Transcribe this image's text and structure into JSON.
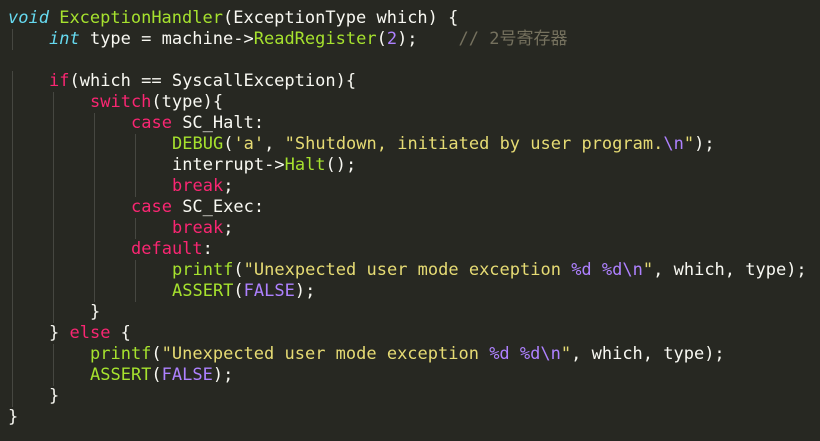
{
  "code": {
    "lines": [
      {
        "indent": 0,
        "tokens": [
          {
            "t": "void",
            "k": "type"
          },
          {
            "t": " ",
            "k": "plain"
          },
          {
            "t": "ExceptionHandler",
            "k": "fn"
          },
          {
            "t": "(ExceptionType which) {",
            "k": "plain"
          }
        ]
      },
      {
        "indent": 1,
        "tokens": [
          {
            "t": "int",
            "k": "type"
          },
          {
            "t": " type = machine",
            "k": "plain"
          },
          {
            "t": "->",
            "k": "plain"
          },
          {
            "t": "ReadRegister",
            "k": "fn"
          },
          {
            "t": "(",
            "k": "plain"
          },
          {
            "t": "2",
            "k": "num"
          },
          {
            "t": ");",
            "k": "plain"
          },
          {
            "t": "    ",
            "k": "plain"
          },
          {
            "t": "// 2号寄存器",
            "k": "cmt"
          }
        ]
      },
      {
        "indent": 0,
        "tokens": []
      },
      {
        "indent": 1,
        "tokens": [
          {
            "t": "if",
            "k": "kw"
          },
          {
            "t": "(which == SyscallException){",
            "k": "plain"
          }
        ]
      },
      {
        "indent": 2,
        "tokens": [
          {
            "t": "switch",
            "k": "kw"
          },
          {
            "t": "(type){",
            "k": "plain"
          }
        ]
      },
      {
        "indent": 3,
        "tokens": [
          {
            "t": "case",
            "k": "kw"
          },
          {
            "t": " SC_Halt:",
            "k": "plain"
          }
        ]
      },
      {
        "indent": 4,
        "tokens": [
          {
            "t": "DEBUG",
            "k": "fn"
          },
          {
            "t": "(",
            "k": "plain"
          },
          {
            "t": "'a'",
            "k": "str"
          },
          {
            "t": ", ",
            "k": "plain"
          },
          {
            "t": "\"Shutdown, initiated by user program.",
            "k": "str"
          },
          {
            "t": "\\n",
            "k": "esc"
          },
          {
            "t": "\"",
            "k": "str"
          },
          {
            "t": ");",
            "k": "plain"
          }
        ]
      },
      {
        "indent": 4,
        "tokens": [
          {
            "t": "interrupt->",
            "k": "plain"
          },
          {
            "t": "Halt",
            "k": "fn"
          },
          {
            "t": "();",
            "k": "plain"
          }
        ]
      },
      {
        "indent": 4,
        "tokens": [
          {
            "t": "break",
            "k": "kw"
          },
          {
            "t": ";",
            "k": "plain"
          }
        ]
      },
      {
        "indent": 3,
        "tokens": [
          {
            "t": "case",
            "k": "kw"
          },
          {
            "t": " SC_Exec:",
            "k": "plain"
          }
        ]
      },
      {
        "indent": 4,
        "tokens": [
          {
            "t": "break",
            "k": "kw"
          },
          {
            "t": ";",
            "k": "plain"
          }
        ]
      },
      {
        "indent": 3,
        "tokens": [
          {
            "t": "default",
            "k": "kw"
          },
          {
            "t": ":",
            "k": "plain"
          }
        ]
      },
      {
        "indent": 4,
        "tokens": [
          {
            "t": "printf",
            "k": "fn"
          },
          {
            "t": "(",
            "k": "plain"
          },
          {
            "t": "\"Unexpected user mode exception ",
            "k": "str"
          },
          {
            "t": "%d",
            "k": "esc"
          },
          {
            "t": " ",
            "k": "str"
          },
          {
            "t": "%d",
            "k": "esc"
          },
          {
            "t": "\\n",
            "k": "esc"
          },
          {
            "t": "\"",
            "k": "str"
          },
          {
            "t": ", which, type);",
            "k": "plain"
          }
        ]
      },
      {
        "indent": 4,
        "tokens": [
          {
            "t": "ASSERT",
            "k": "fn"
          },
          {
            "t": "(",
            "k": "plain"
          },
          {
            "t": "FALSE",
            "k": "const"
          },
          {
            "t": ");",
            "k": "plain"
          }
        ]
      },
      {
        "indent": 2,
        "tokens": [
          {
            "t": "}",
            "k": "plain"
          }
        ]
      },
      {
        "indent": 1,
        "tokens": [
          {
            "t": "} ",
            "k": "plain"
          },
          {
            "t": "else",
            "k": "kw"
          },
          {
            "t": " {",
            "k": "plain"
          }
        ]
      },
      {
        "indent": 2,
        "tokens": [
          {
            "t": "printf",
            "k": "fn"
          },
          {
            "t": "(",
            "k": "plain"
          },
          {
            "t": "\"Unexpected user mode exception ",
            "k": "str"
          },
          {
            "t": "%d",
            "k": "esc"
          },
          {
            "t": " ",
            "k": "str"
          },
          {
            "t": "%d",
            "k": "esc"
          },
          {
            "t": "\\n",
            "k": "esc"
          },
          {
            "t": "\"",
            "k": "str"
          },
          {
            "t": ", which, type);",
            "k": "plain"
          }
        ]
      },
      {
        "indent": 2,
        "tokens": [
          {
            "t": "ASSERT",
            "k": "fn"
          },
          {
            "t": "(",
            "k": "plain"
          },
          {
            "t": "FALSE",
            "k": "const"
          },
          {
            "t": ");",
            "k": "plain"
          }
        ]
      },
      {
        "indent": 1,
        "tokens": [
          {
            "t": "}",
            "k": "plain"
          }
        ]
      },
      {
        "indent": 0,
        "tokens": [
          {
            "t": "}",
            "k": "plain"
          }
        ]
      }
    ]
  },
  "theme": {
    "background": "#272822",
    "foreground": "#f8f8f2",
    "keyword": "#f92672",
    "type": "#66d9ef",
    "function": "#a6e22e",
    "string": "#e6db74",
    "number": "#ae81ff",
    "comment": "#75715e"
  }
}
